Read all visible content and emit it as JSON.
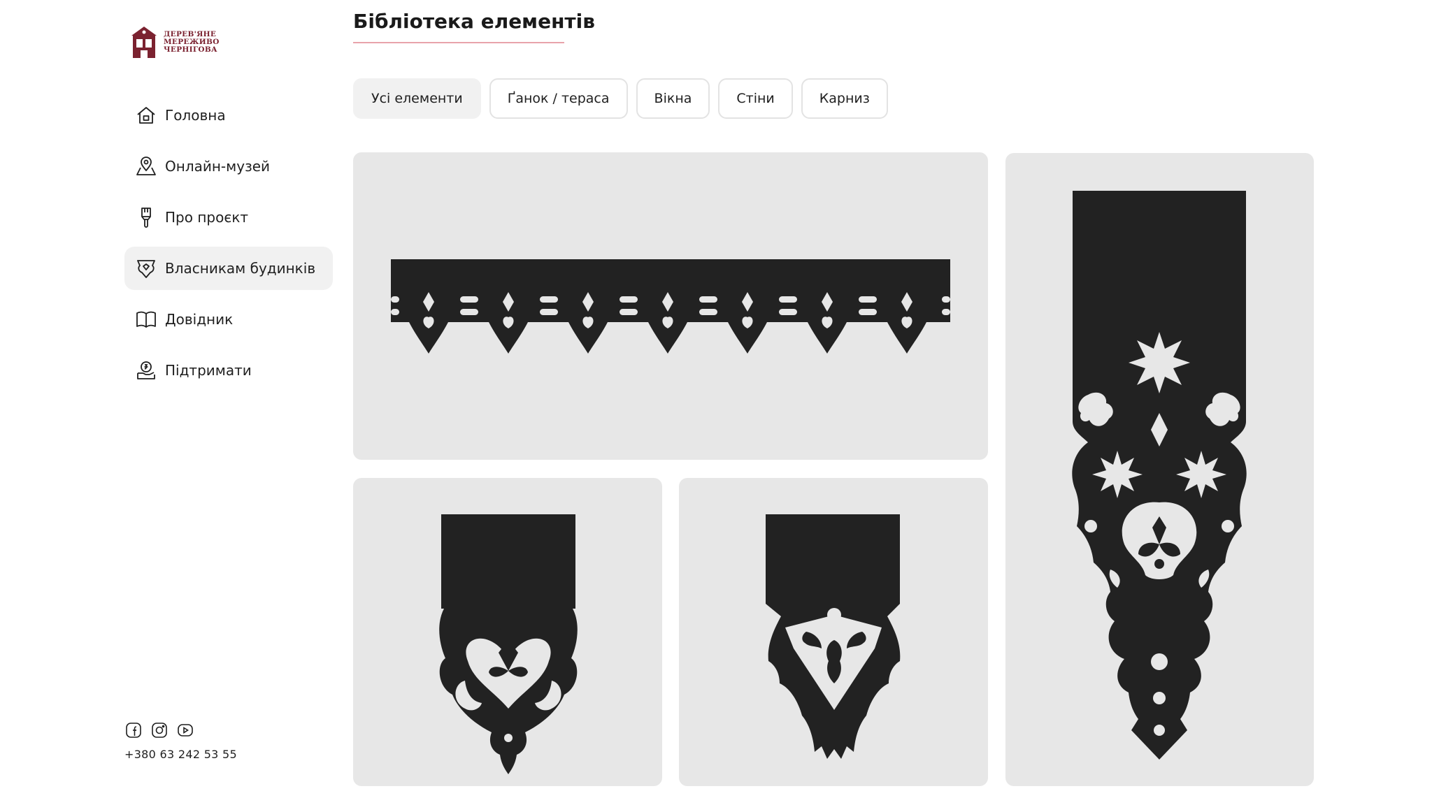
{
  "logo": {
    "lines": [
      "ДЕРЕВ'ЯНЕ",
      "МЕРЕЖИВО",
      "ЧЕРНІГОВА"
    ],
    "brand_color": "#7b2230"
  },
  "nav": {
    "items": [
      {
        "label": "Головна",
        "icon": "home-icon",
        "active": false
      },
      {
        "label": "Онлайн-музей",
        "icon": "map-pin-icon",
        "active": false
      },
      {
        "label": "Про проєкт",
        "icon": "brush-icon",
        "active": false
      },
      {
        "label": "Власникам будинків",
        "icon": "carving-icon",
        "active": true
      },
      {
        "label": "Довідник",
        "icon": "book-icon",
        "active": false
      },
      {
        "label": "Підтримати",
        "icon": "donate-icon",
        "active": false
      }
    ]
  },
  "socials": [
    "facebook-icon",
    "instagram-icon",
    "youtube-icon"
  ],
  "contact": {
    "phone": "+380 63 242 53 55"
  },
  "page": {
    "title": "Бібліотека елементів",
    "accent_color": "#e8a3ab"
  },
  "filters": {
    "tabs": [
      {
        "label": "Усі елементи",
        "active": true
      },
      {
        "label": "Ґанок / тераса",
        "active": false
      },
      {
        "label": "Вікна",
        "active": false
      },
      {
        "label": "Стіни",
        "active": false
      },
      {
        "label": "Карниз",
        "active": false
      }
    ]
  },
  "library": {
    "card_color": "#e7e7e7",
    "ornament_color": "#222222",
    "items": [
      {
        "name": "eave-trim-ornament"
      },
      {
        "name": "bracket-ornament-heart"
      },
      {
        "name": "bracket-ornament-diamond"
      },
      {
        "name": "pilaster-ornament-tall"
      }
    ]
  }
}
